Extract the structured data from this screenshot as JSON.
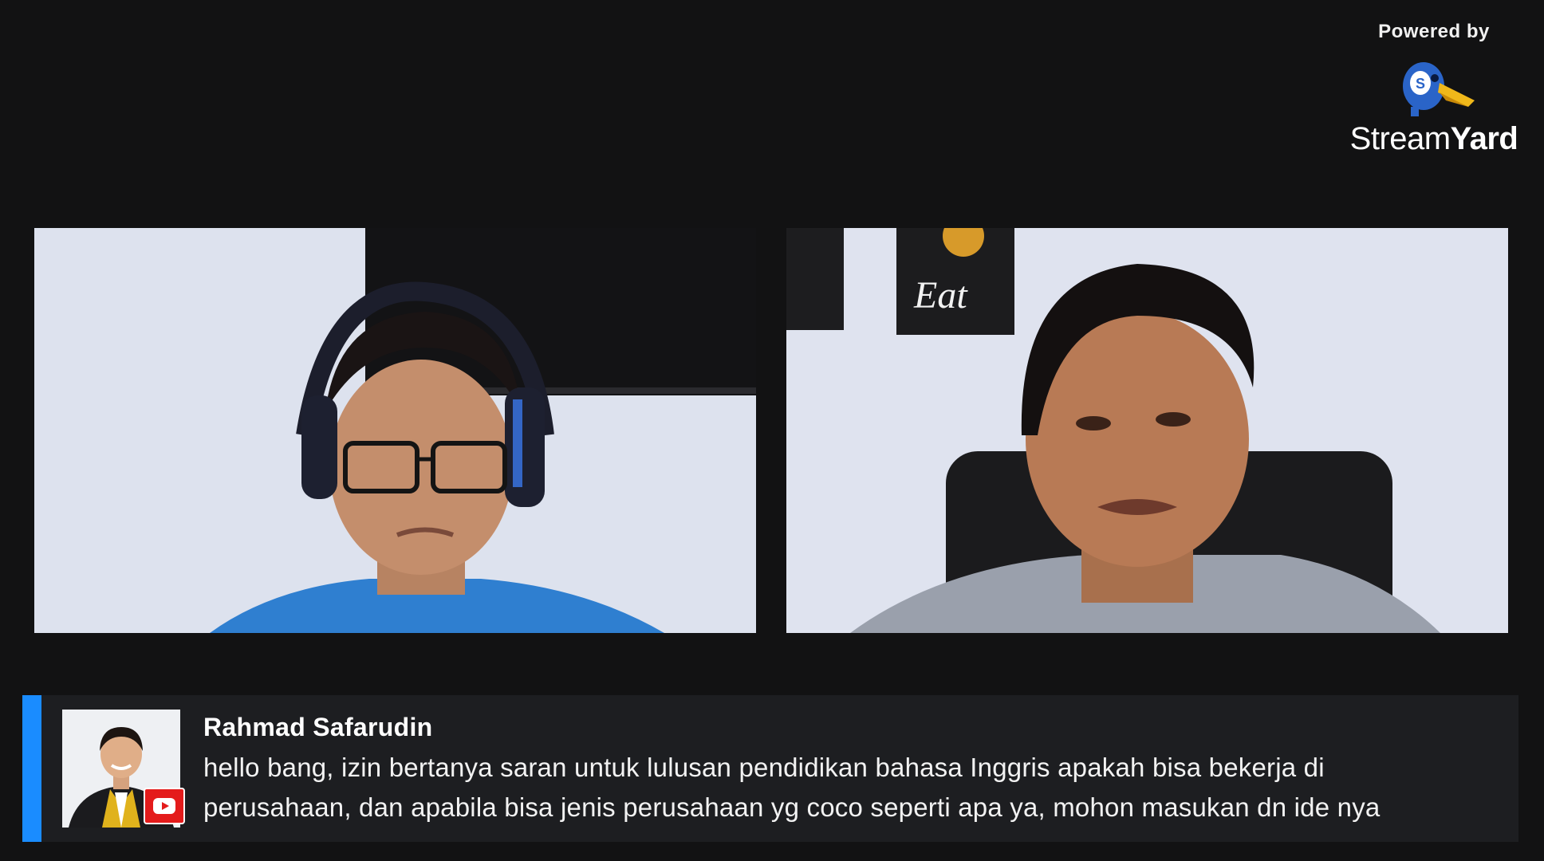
{
  "branding": {
    "powered_by": "Powered by",
    "name_light": "Stream",
    "name_bold": "Yard"
  },
  "participants": [
    {
      "id": "guest-left",
      "description_icon": "person-with-headphones"
    },
    {
      "id": "guest-right",
      "description_icon": "person"
    }
  ],
  "comment": {
    "author": "Rahmad Safarudin",
    "line1": "hello bang, izin bertanya saran untuk lulusan pendidikan bahasa Inggris apakah bisa bekerja di",
    "line2": "perusahaan, dan apabila bisa jenis perusahaan yg coco seperti apa ya, mohon masukan dn ide nya",
    "platform_icon": "youtube-icon"
  },
  "colors": {
    "background": "#121213",
    "accent": "#1a8cff",
    "comment_bg": "#1d1e21",
    "youtube_red": "#e41b1b"
  }
}
